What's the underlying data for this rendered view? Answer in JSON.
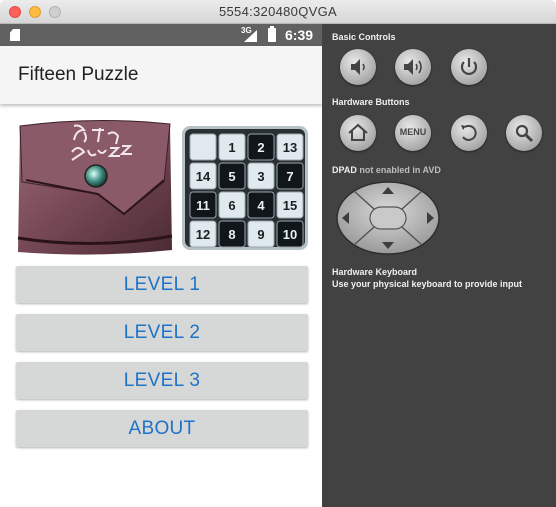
{
  "window": {
    "title": "5554:320480QVGA"
  },
  "statusbar": {
    "network": "3G",
    "time": "6:39"
  },
  "app": {
    "title": "Fifteen Puzzle",
    "buttons": [
      "LEVEL 1",
      "LEVEL 2",
      "LEVEL 3",
      "ABOUT"
    ],
    "puzzle_tiles": [
      [
        "",
        "1",
        "2",
        "13"
      ],
      [
        "14",
        "5",
        "3",
        "7"
      ],
      [
        "11",
        "6",
        "4",
        "15"
      ],
      [
        "12",
        "8",
        "9",
        "10"
      ]
    ]
  },
  "emulator": {
    "basic_controls_label": "Basic Controls",
    "hardware_buttons_label": "Hardware Buttons",
    "menu_button_label": "MENU",
    "dpad_label": "DPAD",
    "dpad_note": "not enabled in AVD",
    "keyboard_label": "Hardware Keyboard",
    "keyboard_note": "Use your physical keyboard to provide input"
  },
  "colors": {
    "button_text": "#1e73c8",
    "button_bg": "#d6d7d7",
    "statusbar_bg": "#616161",
    "panel_bg": "#424242"
  }
}
